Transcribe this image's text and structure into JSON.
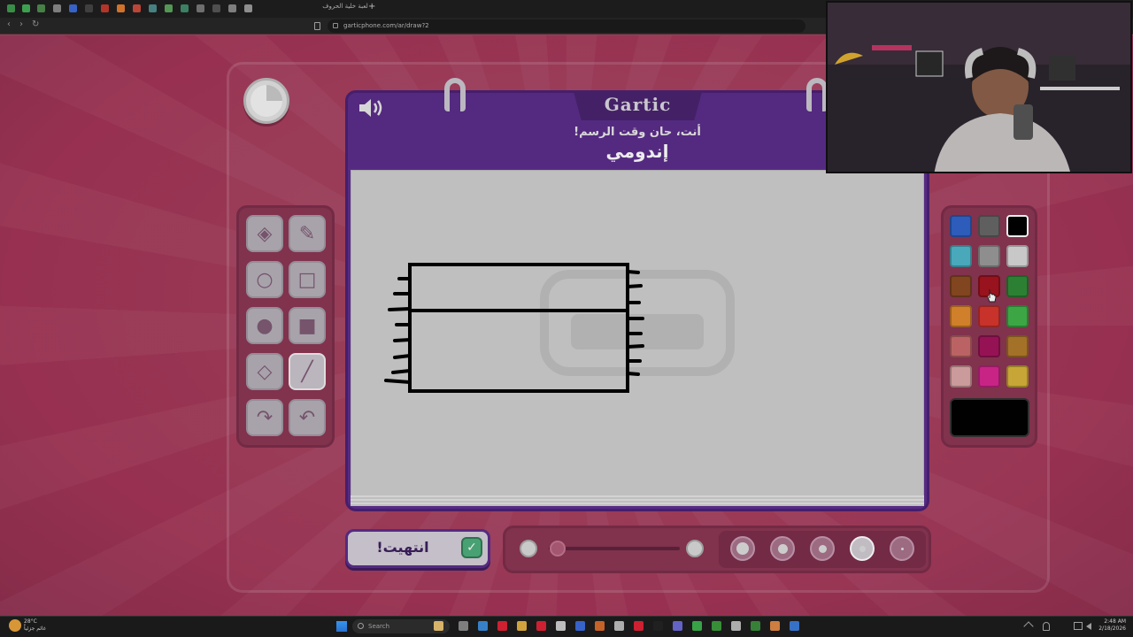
{
  "browser": {
    "tab_title": "لعبة خلية الحروف",
    "new_tab": "+",
    "url": "garticphone.com/ar/draw?2",
    "back": "‹",
    "forward": "›",
    "reload": "↻"
  },
  "game": {
    "logo": "Gartic",
    "subtitle": "أنت، حان وقت الرسم!",
    "word": "إندومي",
    "done_label": "انتهيت!",
    "done_check": "✓"
  },
  "tools": [
    {
      "name": "eraser-tool",
      "icon": "eraser-icon",
      "glyph": "◈"
    },
    {
      "name": "pencil-tool",
      "icon": "pencil-icon",
      "glyph": "✎"
    },
    {
      "name": "ellipse-outline-tool",
      "icon": "circle-outline-icon",
      "glyph": "○"
    },
    {
      "name": "rect-outline-tool",
      "icon": "square-outline-icon",
      "glyph": "□"
    },
    {
      "name": "ellipse-fill-tool",
      "icon": "circle-filled-icon",
      "glyph": "●"
    },
    {
      "name": "rect-fill-tool",
      "icon": "square-filled-icon",
      "glyph": "■"
    },
    {
      "name": "fill-tool",
      "icon": "paint-bucket-icon",
      "glyph": "◇"
    },
    {
      "name": "line-tool",
      "icon": "line-icon",
      "glyph": "╱",
      "active": true
    },
    {
      "name": "redo-tool",
      "icon": "redo-icon",
      "glyph": "↷"
    },
    {
      "name": "undo-tool",
      "icon": "undo-icon",
      "glyph": "↶"
    }
  ],
  "palette": {
    "colors": [
      "#2f63c8",
      "#666666",
      "#000000",
      "#4fb6c9",
      "#9a9a9a",
      "#d8d8d8",
      "#8a4a20",
      "#a3141e",
      "#2e8a36",
      "#e08a2c",
      "#d6362d",
      "#3fb349",
      "#c96b6b",
      "#a0145a",
      "#b07a2a",
      "#dba6a6",
      "#d6278f",
      "#d6b43a"
    ],
    "selected_index": 2,
    "current": "#000000"
  },
  "brush": {
    "size_options": 5,
    "selected_size_index": 3,
    "opacity": 0.08
  },
  "taskbar": {
    "temperature": "28°C",
    "weather_text": "غائم جزئياً",
    "search_placeholder": "Search",
    "time": "2:48 AM",
    "date": "2/18/2026"
  }
}
